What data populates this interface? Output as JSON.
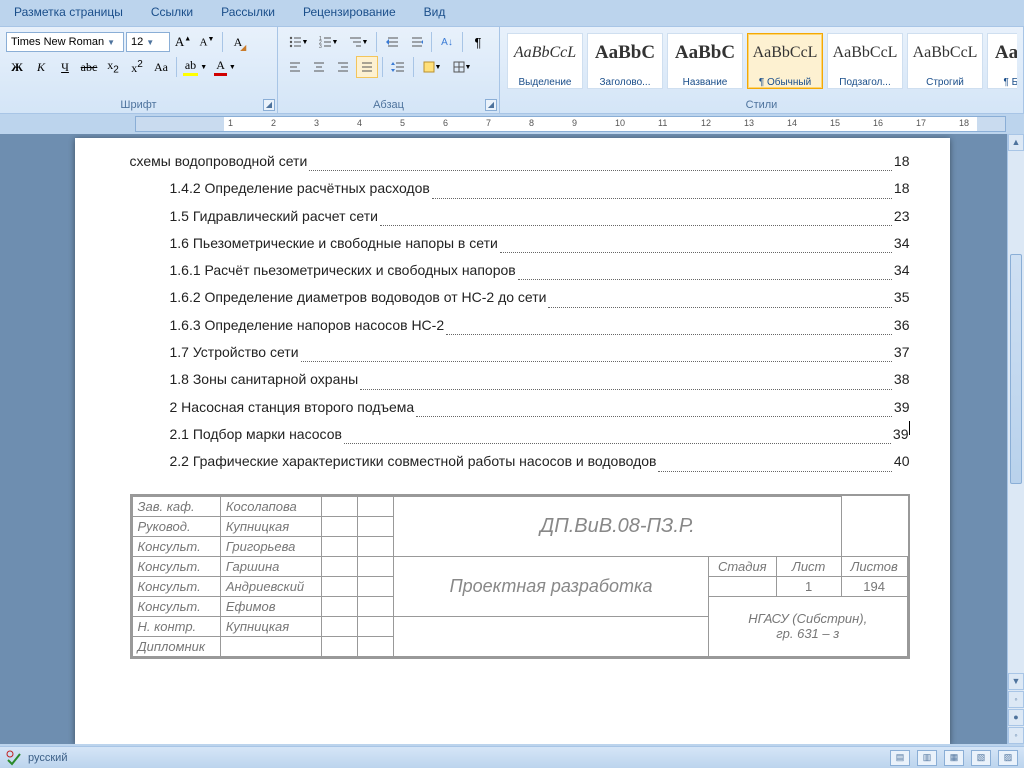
{
  "tabs": [
    "Разметка страницы",
    "Ссылки",
    "Рассылки",
    "Рецензирование",
    "Вид"
  ],
  "font": {
    "name": "Times New Roman",
    "size": "12",
    "group_label": "Шрифт"
  },
  "paragraph": {
    "group_label": "Абзац"
  },
  "styles": {
    "group_label": "Стили",
    "items": [
      {
        "sample": "AaBbCcL",
        "name": "Выделение"
      },
      {
        "sample": "AaBbC",
        "name": "Заголово..."
      },
      {
        "sample": "AaBbC",
        "name": "Название"
      },
      {
        "sample": "AaBbCcL",
        "name": "¶ Обычный"
      },
      {
        "sample": "AaBbCcL",
        "name": "Подзагол..."
      },
      {
        "sample": "AaBbCcL",
        "name": "Строгий"
      },
      {
        "sample": "AaBbC",
        "name": "¶ Без инт"
      }
    ],
    "selected": 3
  },
  "toc": [
    {
      "indent": 0,
      "text": "схемы водопроводной сети ",
      "page": "18"
    },
    {
      "indent": 1,
      "text": "1.4.2 Определение расчётных расходов",
      "page": "18"
    },
    {
      "indent": 1,
      "text": "1.5 Гидравлический расчет сети",
      "page": "23"
    },
    {
      "indent": 1,
      "text": "1.6 Пьезометрические и свободные напоры в сети",
      "page": "34"
    },
    {
      "indent": 1,
      "text": "1.6.1 Расчёт пьезометрических и свободных напоров",
      "page": "34"
    },
    {
      "indent": 1,
      "text": "1.6.2 Определение диаметров водоводов от НС-2 до сети ",
      "page": "35"
    },
    {
      "indent": 1,
      "text": "1.6.3 Определение напоров насосов НС-2",
      "page": "36"
    },
    {
      "indent": 1,
      "text": "1.7 Устройство сети",
      "page": "37"
    },
    {
      "indent": 1,
      "text": "1.8 Зоны санитарной охраны",
      "page": "38"
    },
    {
      "indent": 1,
      "text": "2 Насосная станция второго подъема",
      "page": "39"
    },
    {
      "indent": 1,
      "text": "2.1 Подбор марки насосов",
      "page": "39",
      "cursor": true
    },
    {
      "indent": 1,
      "text": "2.2 Графические характеристики совместной работы насосов и водоводов ",
      "page": "40"
    }
  ],
  "titleblock": {
    "rows": [
      {
        "role": "Зав. каф.",
        "name": "Косолапова"
      },
      {
        "role": "Руковод.",
        "name": "Купницкая"
      },
      {
        "role": "Консульт.",
        "name": "Григорьева"
      },
      {
        "role": "Консульт.",
        "name": "Гаршина"
      },
      {
        "role": "Консульт.",
        "name": "Андриевский"
      },
      {
        "role": "Консульт.",
        "name": "Ефимов"
      },
      {
        "role": "Н. контр.",
        "name": "Купницкая"
      },
      {
        "role": "Дипломник",
        "name": ""
      }
    ],
    "code": "ДП.ВиВ.08-ПЗ.Р.",
    "title": "Проектная разработка",
    "h_stage": "Стадия",
    "h_sheet": "Лист",
    "h_sheets": "Листов",
    "v_stage": "",
    "v_sheet": "1",
    "v_sheets": "194",
    "org": "НГАСУ (Сибстрин),\nгр. 631 – з"
  },
  "status": {
    "lang": "русский"
  },
  "ruler_nums": [
    "1",
    "2",
    "1",
    "2",
    "3",
    "4",
    "5",
    "6",
    "7",
    "8",
    "9",
    "10",
    "11",
    "12",
    "13",
    "14",
    "15",
    "16",
    "17",
    "18"
  ]
}
